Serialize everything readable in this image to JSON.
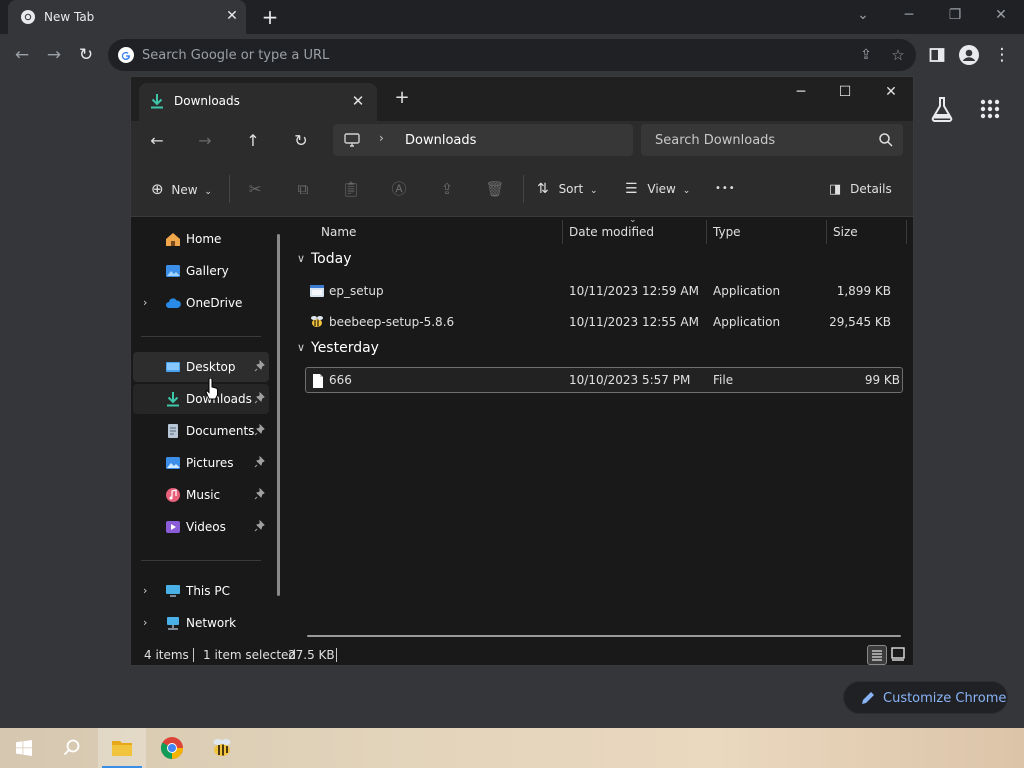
{
  "chrome": {
    "tab_title": "New Tab",
    "omnibox_placeholder": "Search Google or type a URL",
    "customize_label": "Customize Chrome"
  },
  "explorer": {
    "tab_title": "Downloads",
    "breadcrumb": "Downloads",
    "search_placeholder": "Search Downloads",
    "toolbar": {
      "new_label": "New",
      "sort_label": "Sort",
      "view_label": "View",
      "more_label": "•••",
      "details_label": "Details"
    },
    "sidebar": {
      "items": [
        {
          "label": "Home"
        },
        {
          "label": "Gallery"
        },
        {
          "label": "OneDrive"
        },
        {
          "label": "Desktop"
        },
        {
          "label": "Downloads"
        },
        {
          "label": "Documents"
        },
        {
          "label": "Pictures"
        },
        {
          "label": "Music"
        },
        {
          "label": "Videos"
        },
        {
          "label": "This PC"
        },
        {
          "label": "Network"
        }
      ]
    },
    "columns": {
      "name": "Name",
      "date": "Date modified",
      "type": "Type",
      "size": "Size"
    },
    "groups": [
      {
        "label": "Today",
        "files": [
          {
            "name": "ep_setup",
            "date": "10/11/2023 12:59 AM",
            "type": "Application",
            "size": "1,899 KB"
          },
          {
            "name": "beebeep-setup-5.8.6",
            "date": "10/11/2023 12:55 AM",
            "type": "Application",
            "size": "29,545 KB"
          }
        ]
      },
      {
        "label": "Yesterday",
        "files": [
          {
            "name": "666",
            "date": "10/10/2023 5:57 PM",
            "type": "File",
            "size": "99 KB"
          }
        ]
      }
    ],
    "status": {
      "count": "4 items",
      "selection": "1 item selected",
      "size": "27.5 KB"
    }
  },
  "colors": {
    "chrome_bg": "#35363a",
    "chrome_frame": "#202124",
    "explorer_bg": "#191919",
    "explorer_bar": "#2c2c2c",
    "accent_blue": "#8ab4f8",
    "downloads_green": "#3ec6a8",
    "folder_yellow": "#f2c33c"
  }
}
